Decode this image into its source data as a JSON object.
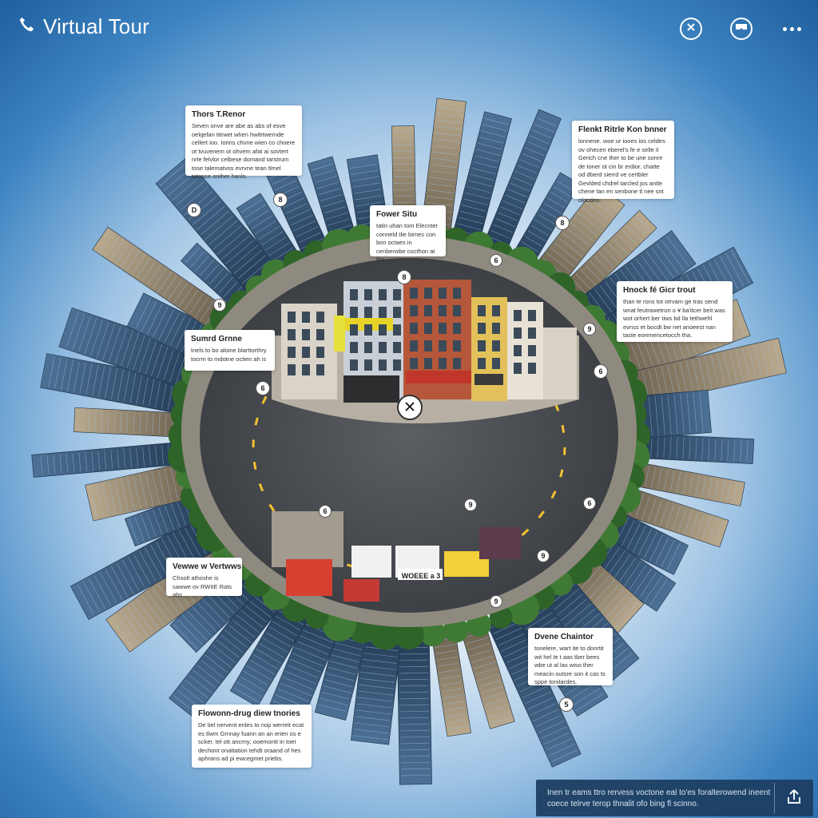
{
  "app": {
    "title": "Virtual Tour"
  },
  "header_icons": {
    "left_icon": "phone-icon",
    "buttons": [
      "close-circle-icon",
      "vr-headset-icon",
      "more-icon"
    ]
  },
  "hotspots": [
    {
      "id": "a",
      "title": "Thors T.Renor",
      "body": "Seven onve are abe as abs of esve oelqefan titrwet when hwitrtwernde cellert ioo. Iorins chvne wien co choere ot tvuvenem ot ohvem afat ai sovtert nrle felvlor celbese domand tarstrum tose talematvos evrvne tean tlmel tctonce onther hanls.",
      "pin_label": "D"
    },
    {
      "id": "b",
      "title": "Fower Situ",
      "body": "tatin uhan tom Elecnter conneld tlie bimes con bon octaes in cenberwbe cocthon at tho.",
      "pin_label": "8"
    },
    {
      "id": "c",
      "title": "Flenkt Ritrle Kon bnner",
      "body": "lonnene. woe ur iooes ios celdes ov ohecen eberel's fe e selle il Gerich cne ther to be une sonre de toner ot cin br erdior. chatte od dberd sierrd ve certbler Gevlded chdrel tarcled jos antle chene tan en senbone tl nee snt olocdeo.",
      "pin_label": "8"
    },
    {
      "id": "d",
      "title": "Hnock fé Gicr trout",
      "body": "than te rons tot otrvam ge tras send wnat feutrawetron o ¥ ba'itcer beit was wot orhert ber tiws bd lla tethwehl evnss et bocdt bw net anoeest nan taste eorenencetocch tha.",
      "pin_label": "6"
    },
    {
      "id": "e",
      "title": "Sumrd Grnne",
      "body": "tnels to bo aloine blarttorthry tocrm to mdotne octien ah is",
      "pin_label": "6"
    },
    {
      "id": "f",
      "title": "Vewwe w Vertwws",
      "body": "Chsolt athoshe is sawwe ov RWIIE Rats abs",
      "pin_label": "6"
    },
    {
      "id": "g",
      "title": "Dvene Chaintor",
      "body": "tonelere, wart ite to donrtit wit hel Ie t aas tber bees wbe ut al las wiso ther meacin outsre son it cas ts sppe tonitardes.",
      "pin_label": "5"
    },
    {
      "id": "h",
      "title": "Flowonn-drug diew tnories",
      "body": "De tiel nervent enles to nop werreit ecat es tlwm Grnnay fuann an an erien os e scker. tel ott ancrny; ooemontt in toer dechont onattation tehdt oraand of hes aphrans ad pi ewcegmet priebs.",
      "pin_label": ""
    }
  ],
  "center_button": {
    "icon": "close-icon"
  },
  "map_pins": [
    "9",
    "6",
    "9",
    "6",
    "9",
    "6",
    "9",
    "9"
  ],
  "storefront": {
    "sign_text": "WOEEE a 3"
  },
  "footer": {
    "text": "Inen tr eams ttro rervess voctone eal to'es foralterowend ineent coece telrve terop thnalit ofo bing fl scinno.",
    "share_icon": "share-up-icon"
  },
  "colors": {
    "sky_top": "#1f5f9e",
    "sky_glow": "#ffffff",
    "footer_bg": "#1d3f63",
    "road": "#4a4d52",
    "road_marking": "#f2c230"
  }
}
